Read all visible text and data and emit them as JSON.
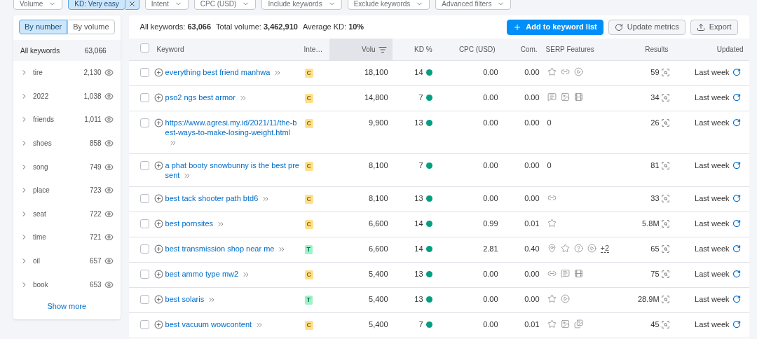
{
  "filters": [
    {
      "label": "Volume",
      "active": false
    },
    {
      "label": "KD: Very easy",
      "active": true
    },
    {
      "label": "Intent",
      "active": false
    },
    {
      "label": "CPC (USD)",
      "active": false
    },
    {
      "label": "Include keywords",
      "active": false
    },
    {
      "label": "Exclude keywords",
      "active": false
    },
    {
      "label": "Advanced filters",
      "active": false
    }
  ],
  "sidebar": {
    "toggle": [
      {
        "label": "By number",
        "selected": true
      },
      {
        "label": "By volume",
        "selected": false
      }
    ],
    "all_label": "All keywords",
    "all_count": "63,066",
    "groups": [
      {
        "name": "tire",
        "count": "2,130"
      },
      {
        "name": "2022",
        "count": "1,038"
      },
      {
        "name": "friends",
        "count": "1,011"
      },
      {
        "name": "shoes",
        "count": "858"
      },
      {
        "name": "song",
        "count": "749"
      },
      {
        "name": "place",
        "count": "723"
      },
      {
        "name": "seat",
        "count": "722"
      },
      {
        "name": "time",
        "count": "721"
      },
      {
        "name": "oil",
        "count": "657"
      },
      {
        "name": "book",
        "count": "653"
      }
    ],
    "show_more": "Show more"
  },
  "summary": [
    {
      "label": "All keywords:",
      "value": "63,066"
    },
    {
      "label": "Total volume:",
      "value": "3,462,910"
    },
    {
      "label": "Average KD:",
      "value": "10%"
    }
  ],
  "actions": [
    {
      "label": "Add to keyword list",
      "kind": "primary"
    },
    {
      "label": "Update metrics",
      "kind": "refresh"
    },
    {
      "label": "Export",
      "kind": "export"
    }
  ],
  "table": {
    "header_checked": false,
    "columns": [
      "Keyword",
      "Inte…",
      "Volu",
      "KD %",
      "CPC (USD)",
      "Com.",
      "SERP Features",
      "Results",
      "Updated"
    ],
    "rows": [
      {
        "checked": false,
        "keyword": "everything best friend manhwa",
        "intent": {
          "label": "C",
          "kind": "commercial"
        },
        "volume": "18,100",
        "kd": "14",
        "cpc": "0.00",
        "com": "0.00",
        "serp": [
          {
            "kind": "star"
          },
          {
            "kind": "link"
          },
          {
            "kind": "play"
          }
        ],
        "results": "59",
        "updated": "Last week"
      },
      {
        "checked": false,
        "keyword": "pso2 ngs best armor",
        "intent": {
          "label": "C",
          "kind": "commercial"
        },
        "volume": "14,800",
        "kd": "7",
        "cpc": "0.00",
        "com": "0.00",
        "serp": [
          {
            "kind": "faq"
          },
          {
            "kind": "image"
          },
          {
            "kind": "video"
          }
        ],
        "results": "34",
        "updated": "Last week"
      },
      {
        "checked": false,
        "keyword": "https://www.agresi.my.id/2021/11/the-best-ways-to-make-losing-weight.html",
        "intent": {
          "label": "C",
          "kind": "commercial"
        },
        "volume": "9,900",
        "kd": "13",
        "cpc": "0.00",
        "com": "0.00",
        "serp_text": "0",
        "results": "26",
        "updated": "Last week"
      },
      {
        "checked": false,
        "keyword": "a phat booty snowbunny is the best present",
        "intent": {
          "label": "C",
          "kind": "commercial"
        },
        "volume": "8,100",
        "kd": "7",
        "cpc": "0.00",
        "com": "0.00",
        "serp_text": "0",
        "results": "81",
        "updated": "Last week"
      },
      {
        "checked": false,
        "keyword": "best tack shooter path btd6",
        "intent": {
          "label": "C",
          "kind": "commercial"
        },
        "volume": "8,100",
        "kd": "13",
        "cpc": "0.00",
        "com": "0.00",
        "serp": [
          {
            "kind": "link"
          }
        ],
        "results": "33",
        "updated": "Last week"
      },
      {
        "checked": false,
        "keyword": "best pornsites",
        "intent": {
          "label": "C",
          "kind": "commercial"
        },
        "volume": "6,600",
        "kd": "14",
        "cpc": "0.99",
        "com": "0.01",
        "serp": [
          {
            "kind": "star"
          }
        ],
        "results": "5.8M",
        "updated": "Last week"
      },
      {
        "checked": false,
        "keyword": "best transmission shop near me",
        "intent": {
          "label": "T",
          "kind": "transactional"
        },
        "volume": "6,600",
        "kd": "14",
        "cpc": "2.81",
        "com": "0.40",
        "serp": [
          {
            "kind": "pin"
          },
          {
            "kind": "star"
          },
          {
            "kind": "question"
          },
          {
            "kind": "play"
          }
        ],
        "serp_more": "+2",
        "results": "65",
        "updated": "Last week"
      },
      {
        "checked": false,
        "keyword": "best ammo type mw2",
        "intent": {
          "label": "C",
          "kind": "commercial"
        },
        "volume": "5,400",
        "kd": "13",
        "cpc": "0.00",
        "com": "0.00",
        "serp": [
          {
            "kind": "link"
          },
          {
            "kind": "faq"
          },
          {
            "kind": "video"
          }
        ],
        "results": "75",
        "updated": "Last week"
      },
      {
        "checked": false,
        "keyword": "best solaris",
        "intent": {
          "label": "T",
          "kind": "transactional"
        },
        "volume": "5,400",
        "kd": "13",
        "cpc": "0.00",
        "com": "0.00",
        "serp": [
          {
            "kind": "star"
          },
          {
            "kind": "play"
          }
        ],
        "results": "28.9M",
        "updated": "Last week"
      },
      {
        "checked": false,
        "keyword": "best vacuum wowcontent",
        "intent": {
          "label": "C",
          "kind": "commercial"
        },
        "volume": "5,400",
        "kd": "7",
        "cpc": "0.00",
        "com": "0.01",
        "serp": [
          {
            "kind": "star"
          },
          {
            "kind": "image"
          },
          {
            "kind": "images"
          }
        ],
        "results": "45",
        "updated": "Last week"
      }
    ]
  }
}
